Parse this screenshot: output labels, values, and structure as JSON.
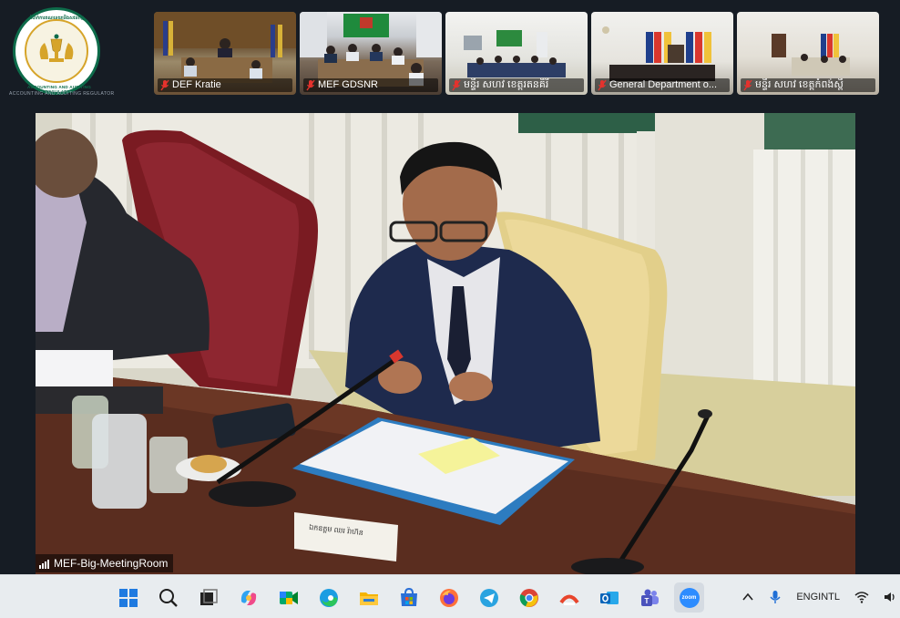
{
  "logo": {
    "top_text": "ដំបាក់ការគណនេយ្យនិងសវនកម្ម",
    "bottom_text": "ACCOUNTING AND AUDITING REGULATOR",
    "sub_text": "ACCOUNTING AND AUDITING REGULATOR"
  },
  "participants": [
    {
      "name": "DEF Kratie",
      "muted": true
    },
    {
      "name": "MEF GDSNR",
      "muted": true
    },
    {
      "name": "មន្ទីរ សហវ ខេត្តរតនគិរី",
      "muted": true
    },
    {
      "name": "General Department o...",
      "muted": true
    },
    {
      "name": "មន្ទីរ សហវ ខេត្តកំពង់ស្ពឺ",
      "muted": true
    }
  ],
  "main_speaker": {
    "room_name": "MEF-Big-MeetingRoom",
    "nameplate": "ឯកឧត្តម ឈរ រ៉ាហ៊ន"
  },
  "taskbar": {
    "apps": [
      {
        "name": "start-icon"
      },
      {
        "name": "search-icon"
      },
      {
        "name": "task-view-icon"
      },
      {
        "name": "copilot-icon"
      },
      {
        "name": "meet-icon"
      },
      {
        "name": "edge-icon"
      },
      {
        "name": "file-explorer-icon"
      },
      {
        "name": "store-icon"
      },
      {
        "name": "firefox-icon"
      },
      {
        "name": "telegram-icon"
      },
      {
        "name": "chrome-icon"
      },
      {
        "name": "anydesk-icon"
      },
      {
        "name": "outlook-icon"
      },
      {
        "name": "teams-icon"
      },
      {
        "name": "zoom-icon"
      }
    ],
    "zoom_label": "zoom",
    "lang_line1": "ENG",
    "lang_line2": "INTL"
  },
  "colors": {
    "background": "#161c24",
    "muted_red": "#e5322d",
    "taskbar": "#e8ecef",
    "logo_green": "#0d6b4a",
    "logo_gold": "#d6a42a"
  }
}
